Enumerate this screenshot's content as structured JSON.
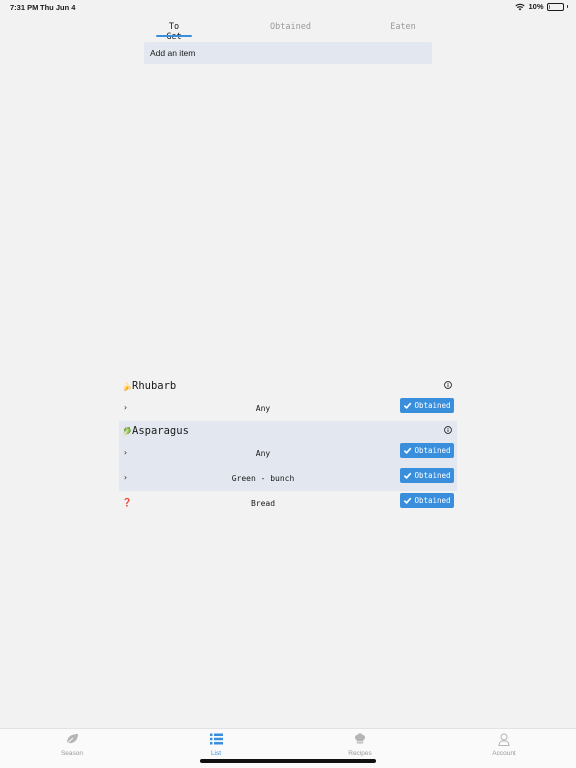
{
  "status": {
    "time": "7:31 PM",
    "date": "Thu Jun 4",
    "battery": "10%",
    "battery_level": 0.1
  },
  "tabs": [
    {
      "label": "To Get",
      "active": true
    },
    {
      "label": "Obtained",
      "active": false
    },
    {
      "label": "Eaten",
      "active": false
    }
  ],
  "add_item": {
    "label": "Add an item"
  },
  "groups": [
    {
      "name": "Rhubarb",
      "emoji": "🍌",
      "rows": [
        {
          "label": "Any",
          "button": "Obtained"
        }
      ]
    },
    {
      "name": "Asparagus",
      "emoji": "🥬",
      "rows": [
        {
          "label": "Any",
          "button": "Obtained"
        },
        {
          "label": "Green - bunch",
          "button": "Obtained"
        }
      ]
    },
    {
      "name": "",
      "rows": [
        {
          "label": "Bread",
          "button": "Obtained",
          "icon": "❓"
        }
      ]
    }
  ],
  "chevron": "›",
  "tabbar": [
    {
      "label": "Season",
      "icon": "leaf-icon",
      "active": false
    },
    {
      "label": "List",
      "icon": "list-icon",
      "active": true
    },
    {
      "label": "Recipes",
      "icon": "chef-hat-icon",
      "active": false
    },
    {
      "label": "Account",
      "icon": "person-icon",
      "active": false
    }
  ],
  "colors": {
    "accent": "#3a8fdd",
    "shaded": "#e3e8f0",
    "background": "#f2f2f2"
  }
}
